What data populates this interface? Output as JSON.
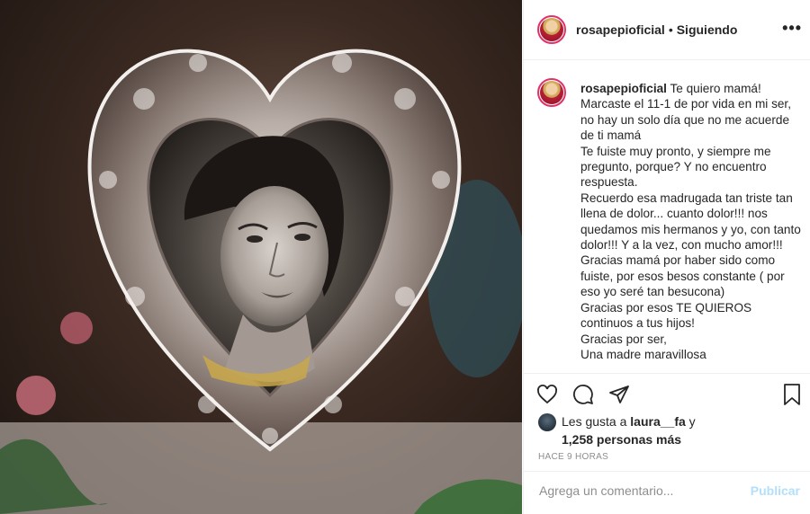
{
  "post": {
    "username": "rosapepioficial",
    "follow_status": "Siguiendo",
    "more_glyph": "•••",
    "image_alt": "Fotografía antigua en blanco y negro de una mujer dentro de un marco de plata en forma de corazón"
  },
  "caption": {
    "username": "rosapepioficial",
    "lines": [
      "Te quiero mamá!",
      "Marcaste el 11-1 de por vida en mi ser, no hay un solo día que no me acuerde de ti mamá",
      "Te fuiste muy pronto, y siempre me pregunto, porque? Y no encuentro respuesta.",
      "Recuerdo esa madrugada tan triste tan llena de dolor... cuanto dolor!!! nos quedamos mis hermanos y yo, con tanto dolor!!! Y a la vez, con mucho amor!!!",
      "Gracias mamá por haber sido como fuiste, por esos besos constante ( por eso yo seré tan besucona)",
      "Gracias por esos TE QUIEROS continuos a tus hijos!",
      "Gracias por ser,",
      "Una madre maravillosa"
    ]
  },
  "actions": {
    "icons": [
      "heart-icon",
      "comment-icon",
      "share-icon",
      "bookmark-icon"
    ]
  },
  "likes": {
    "prefix": "Les gusta a",
    "user": "laura__fa",
    "conj": "y",
    "count_text": "1,258 personas más"
  },
  "time": "HACE 9 HORAS",
  "comment": {
    "placeholder": "Agrega un comentario...",
    "publish_label": "Publicar"
  },
  "colors": {
    "text": "#262626",
    "muted": "#8e8e8e",
    "publish_disabled": "#b2dffc",
    "divider": "#efefef"
  }
}
